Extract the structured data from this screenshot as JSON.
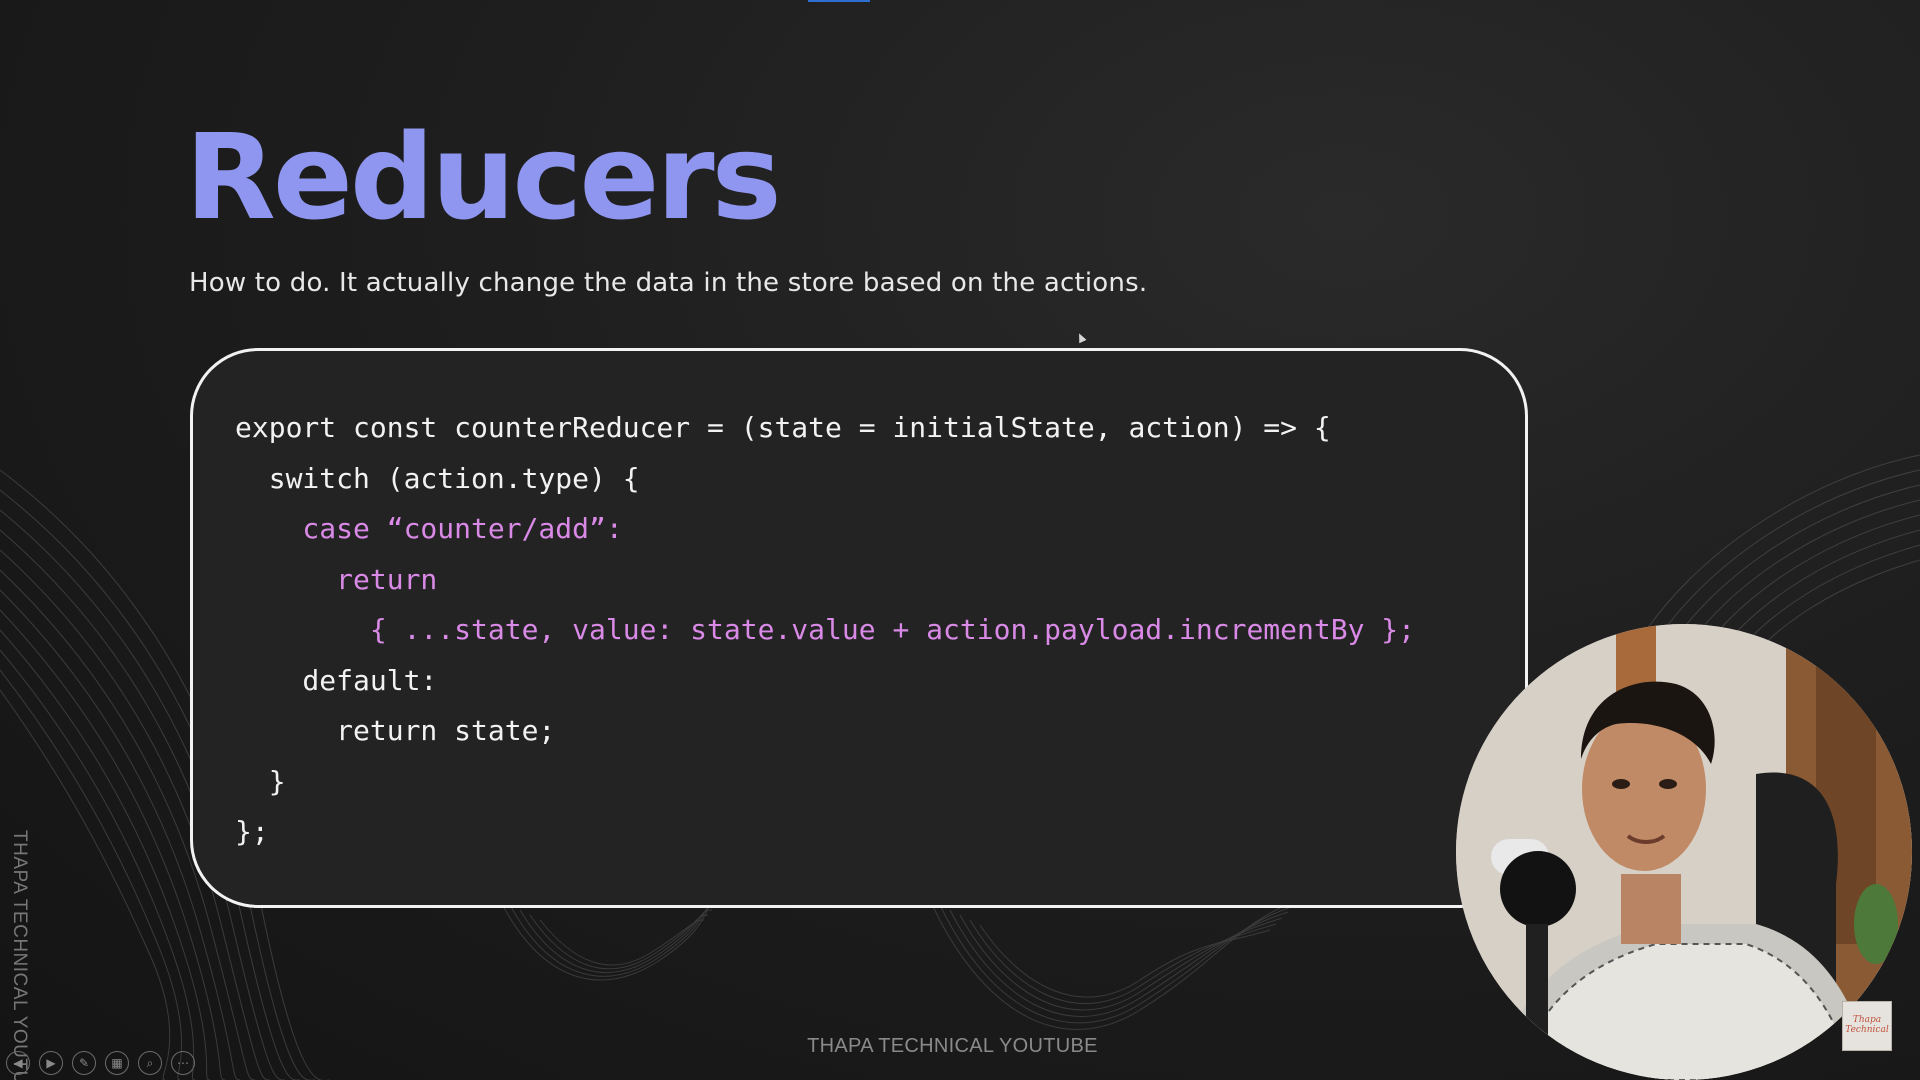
{
  "slide": {
    "title": "Reducers",
    "subtitle": "How to do. It actually change the data in the store based on the actions.",
    "code_lines": [
      "export const counterReducer = (state = initialState, action) => {",
      "  switch (action.type) {",
      "    case “counter/add”:",
      "      return",
      "        { ...state, value: state.value + action.payload.incrementBy };",
      "    default:",
      "      return state;",
      "  }",
      "};"
    ],
    "colors": {
      "title": "#8f96f0",
      "highlight": "#d989e6",
      "code_text": "#f2f2f2",
      "background": "#1b1b1b",
      "box_border": "#f2f2f2"
    }
  },
  "watermark": {
    "side_text": "THAPA TECHNICAL YOUTUBE",
    "footer_text": "THAPA TECHNICAL YOUTUBE"
  },
  "presenter_controls": [
    {
      "icon": "previous-slide-icon",
      "glyph": "◀"
    },
    {
      "icon": "next-slide-icon",
      "glyph": "▶"
    },
    {
      "icon": "pen-icon",
      "glyph": "✎"
    },
    {
      "icon": "slides-grid-icon",
      "glyph": "▦"
    },
    {
      "icon": "zoom-icon",
      "glyph": "⌕"
    },
    {
      "icon": "more-options-icon",
      "glyph": "⋯"
    }
  ],
  "webcam": {
    "icon": "presenter-webcam",
    "logo_text": "Thapa Technical"
  }
}
